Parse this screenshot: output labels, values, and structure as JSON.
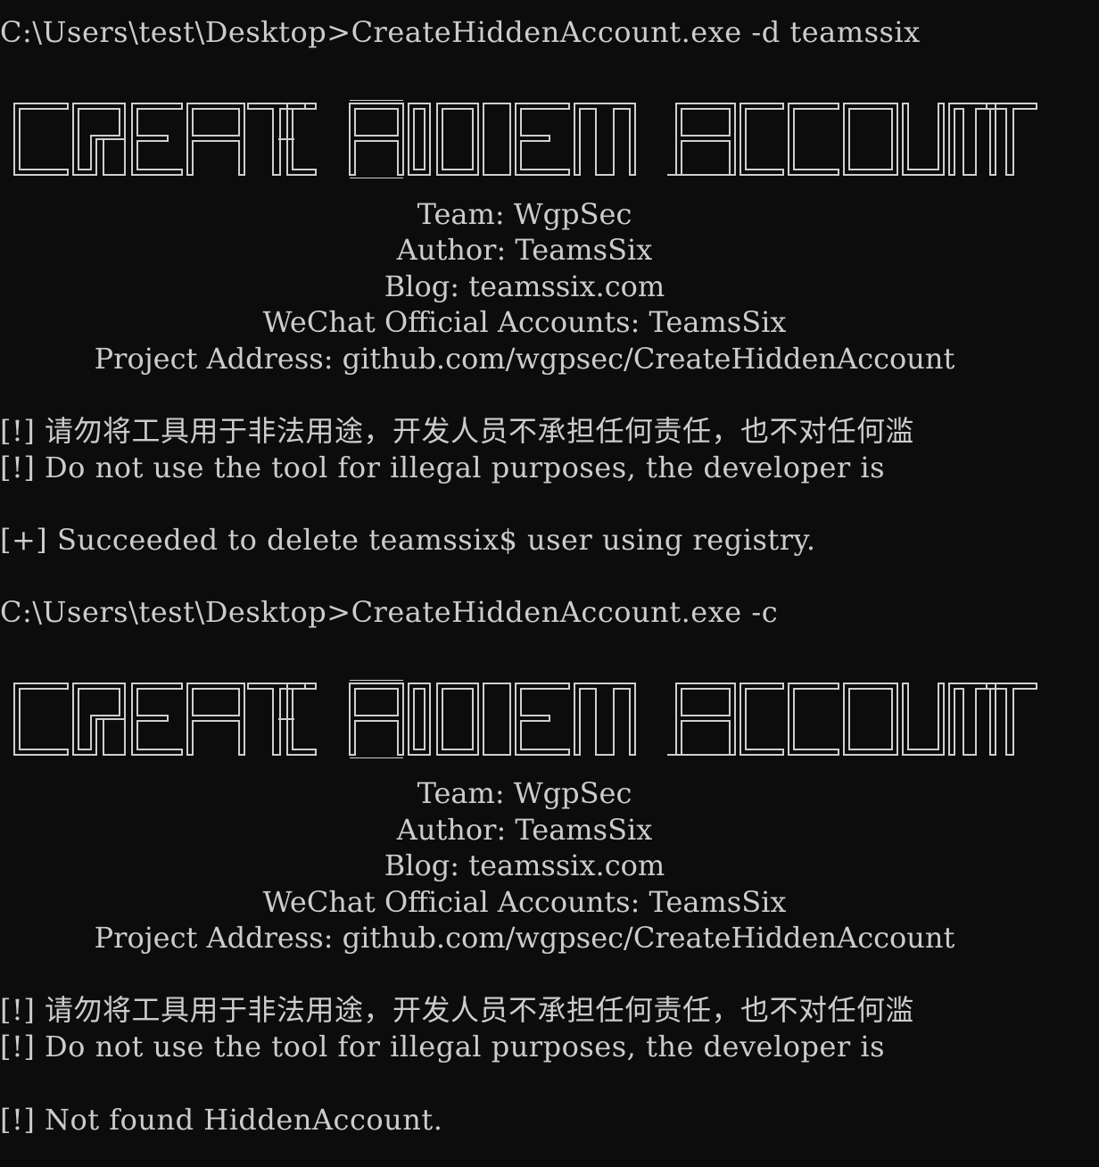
{
  "console": {
    "background": "#0c0c0c",
    "foreground": "#cccccc"
  },
  "session1": {
    "prompt": "C:\\Users\\test\\Desktop>CreateHiddenAccount.exe -d teamssix",
    "banner_text": "CREATE HIDDEN ACCOUNT",
    "team": "Team: WgpSec",
    "author": "Author: TeamsSix",
    "blog": "Blog: teamssix.com",
    "wechat": "WeChat Official Accounts: TeamsSix",
    "project": "Project Address: github.com/wgpsec/CreateHiddenAccount",
    "warning_cn": "[!] 请勿将工具用于非法用途，开发人员不承担任何责任，也不对任何滥",
    "warning_en": "[!] Do not use the tool for illegal purposes, the developer is",
    "result": "[+] Succeeded to delete teamssix$ user using registry."
  },
  "session2": {
    "prompt": "C:\\Users\\test\\Desktop>CreateHiddenAccount.exe -c",
    "banner_text": "CREATE HIDDEN ACCOUNT",
    "team": "Team: WgpSec",
    "author": "Author: TeamsSix",
    "blog": "Blog: teamssix.com",
    "wechat": "WeChat Official Accounts: TeamsSix",
    "project": "Project Address: github.com/wgpsec/CreateHiddenAccount",
    "warning_cn": "[!] 请勿将工具用于非法用途，开发人员不承担任何责任，也不对任何滥",
    "warning_en": "[!] Do not use the tool for illegal purposes, the developer is",
    "result": "[!] Not found HiddenAccount."
  }
}
